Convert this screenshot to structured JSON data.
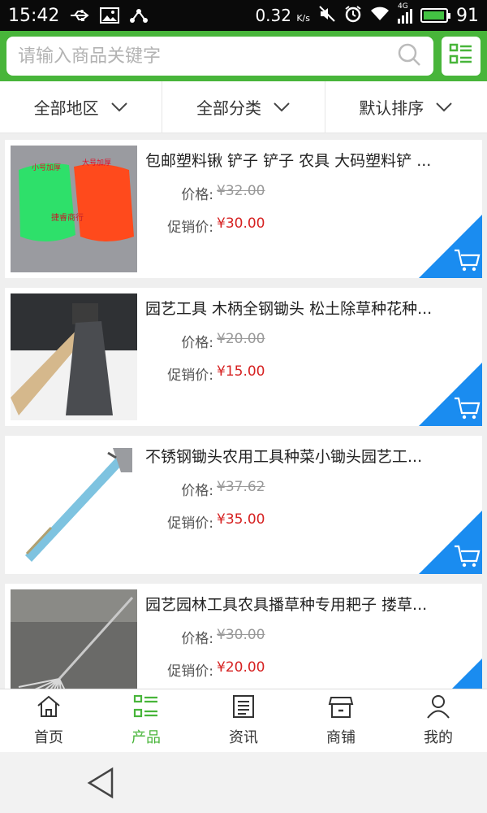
{
  "status_bar": {
    "time": "15:42",
    "network_speed": "0.32",
    "speed_unit": "K/s",
    "network_type": "4G",
    "battery": "91"
  },
  "search": {
    "placeholder": "请输入商品关键字"
  },
  "filters": [
    {
      "label": "全部地区"
    },
    {
      "label": "全部分类"
    },
    {
      "label": "默认排序"
    }
  ],
  "price_label": "价格:",
  "promo_label": "促销价:",
  "products": [
    {
      "title": "包邮塑料锹 铲子 铲子 农具 大码塑料铲 ...",
      "price": "¥32.00",
      "promo_price": "¥30.00",
      "image": "plastic-shovels",
      "image_text": {
        "small": "小号加厚",
        "large": "大号加厚",
        "brand": "捷睿商行"
      }
    },
    {
      "title": "园艺工具 木柄全钢锄头 松土除草种花种...",
      "price": "¥20.00",
      "promo_price": "¥15.00",
      "image": "steel-hoe"
    },
    {
      "title": "不锈钢锄头农用工具种菜小锄头园艺工...",
      "price": "¥37.62",
      "promo_price": "¥35.00",
      "image": "stainless-hoe"
    },
    {
      "title": "园艺园林工具农具播草种专用耙子 搂草...",
      "price": "¥30.00",
      "promo_price": "¥20.00",
      "image": "rake"
    }
  ],
  "bottom_nav": [
    {
      "label": "首页",
      "icon": "home-icon",
      "active": false
    },
    {
      "label": "产品",
      "icon": "list-icon",
      "active": true
    },
    {
      "label": "资讯",
      "icon": "news-icon",
      "active": false
    },
    {
      "label": "商铺",
      "icon": "shop-icon",
      "active": false
    },
    {
      "label": "我的",
      "icon": "user-icon",
      "active": false
    }
  ],
  "colors": {
    "brand_green": "#48b53a",
    "promo_red": "#d62222",
    "cart_blue": "#1a8cf0"
  }
}
